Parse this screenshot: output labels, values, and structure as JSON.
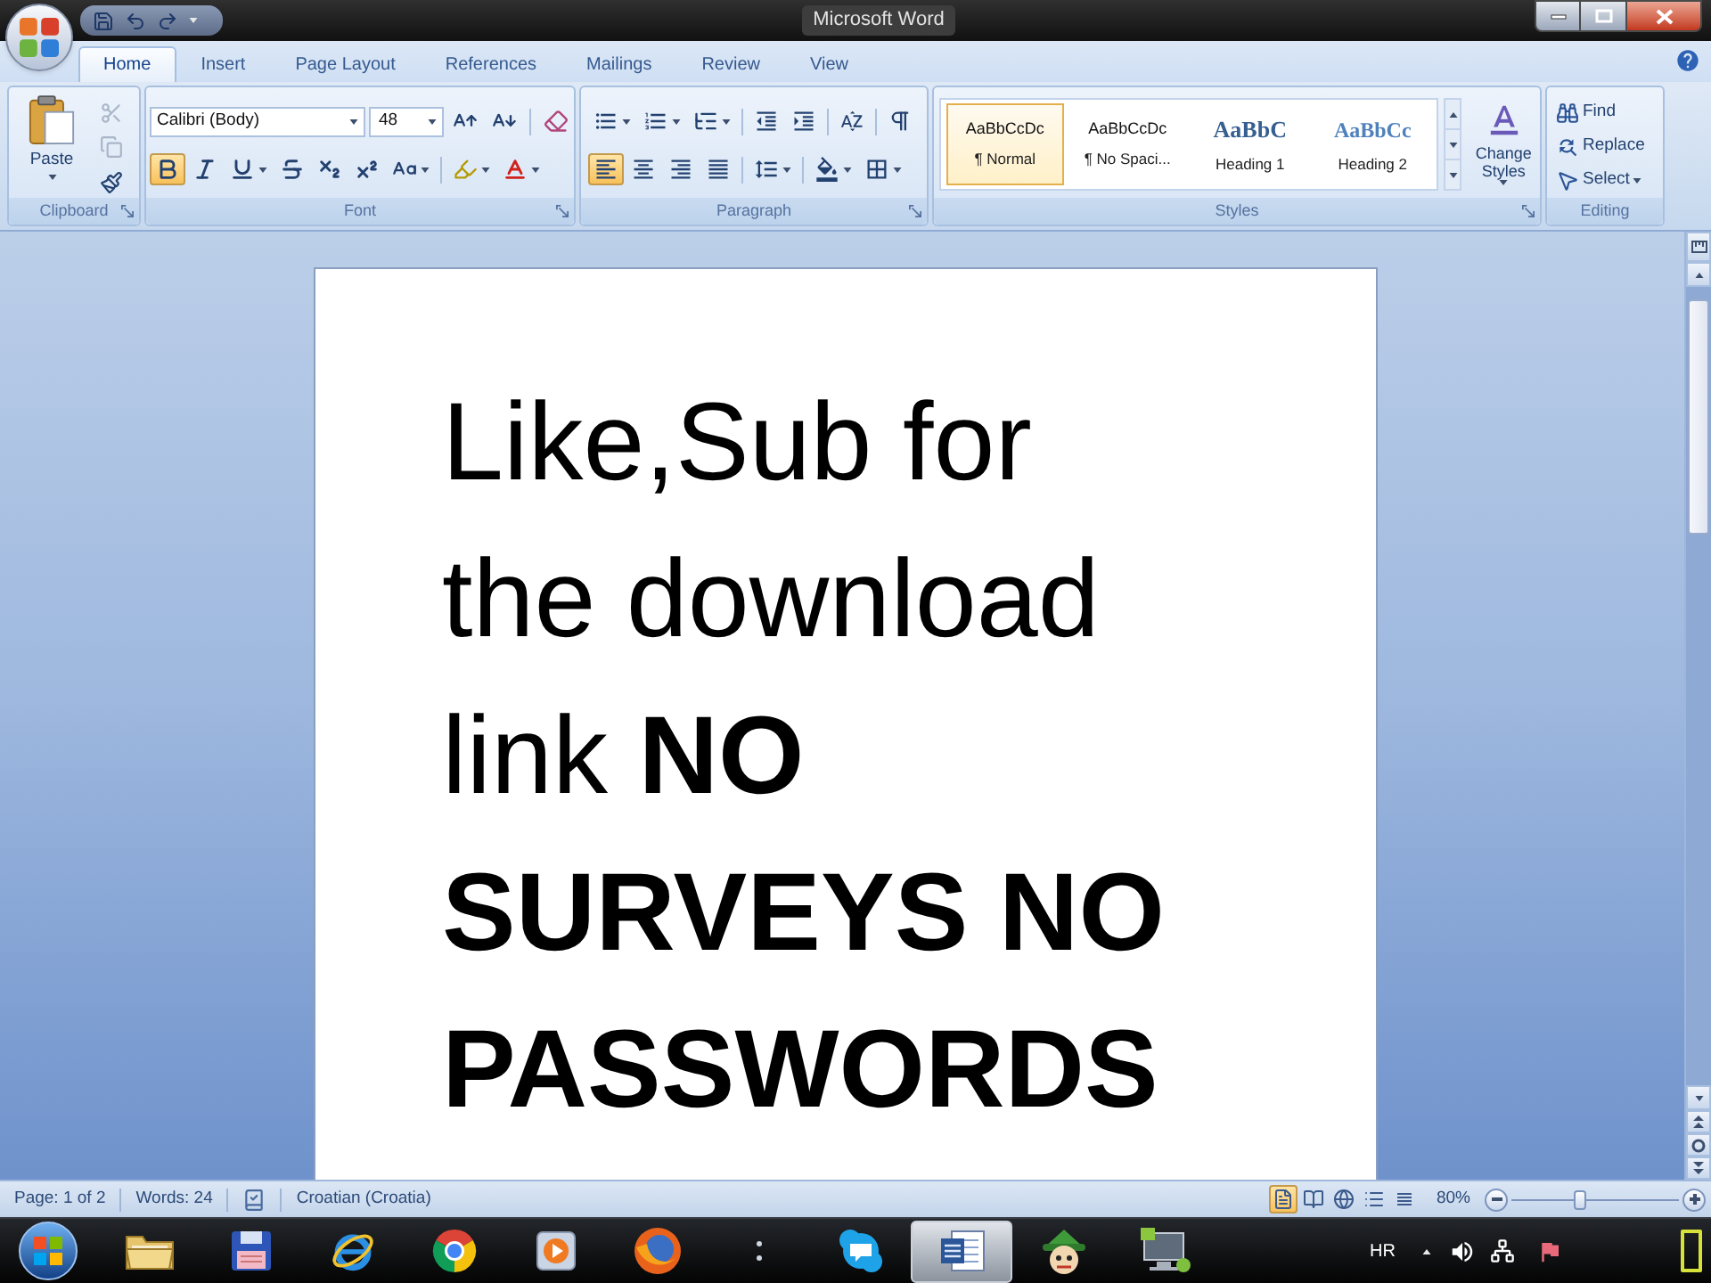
{
  "window": {
    "title": "Microsoft Word"
  },
  "tabs": [
    {
      "label": "Home",
      "selected": true
    },
    {
      "label": "Insert",
      "selected": false
    },
    {
      "label": "Page Layout",
      "selected": false
    },
    {
      "label": "References",
      "selected": false
    },
    {
      "label": "Mailings",
      "selected": false
    },
    {
      "label": "Review",
      "selected": false
    },
    {
      "label": "View",
      "selected": false
    }
  ],
  "clipboard": {
    "label": "Clipboard",
    "paste": "Paste",
    "tools": [
      {
        "kind": "cut",
        "disabled": true
      },
      {
        "kind": "copy",
        "disabled": true
      },
      {
        "kind": "format_painter",
        "disabled": false
      }
    ]
  },
  "font": {
    "label": "Font",
    "font_name": "Calibri (Body)",
    "font_size": "48",
    "bold": true,
    "italic": false,
    "underline": false,
    "strikethrough": false,
    "subscript": false,
    "superscript": false
  },
  "paragraph": {
    "label": "Paragraph",
    "alignments": [
      {
        "kind": "left",
        "selected": true
      },
      {
        "kind": "center",
        "selected": false
      },
      {
        "kind": "right",
        "selected": false
      },
      {
        "kind": "justify",
        "selected": false
      }
    ]
  },
  "styles": {
    "label": "Styles",
    "gallery": [
      {
        "kind": "body",
        "preview": "AaBbCcDc",
        "name": "¶ Normal",
        "selected": true
      },
      {
        "kind": "body",
        "preview": "AaBbCcDc",
        "name": "¶ No Spaci...",
        "selected": false
      },
      {
        "kind": "heading1",
        "preview": "AaBbC",
        "name": "Heading 1",
        "selected": false
      },
      {
        "kind": "heading2",
        "preview": "AaBbCc",
        "name": "Heading 2",
        "selected": false
      }
    ],
    "change_styles": "Change Styles"
  },
  "editing": {
    "label": "Editing",
    "items": [
      {
        "kind": "find",
        "label": "Find"
      },
      {
        "kind": "replace",
        "label": "Replace"
      },
      {
        "kind": "select",
        "label": "Select"
      }
    ]
  },
  "document": {
    "paragraph": "Like,Sub for the download link **NO SURVEYS NO PASSWORDS**"
  },
  "status_bar": {
    "page": "Page: 1 of 2",
    "words": "Words: 24",
    "language": "Croatian (Croatia)",
    "views": [
      {
        "kind": "print_layout",
        "selected": true
      },
      {
        "kind": "full_screen",
        "selected": false
      },
      {
        "kind": "web_layout",
        "selected": false
      },
      {
        "kind": "outline",
        "selected": false
      },
      {
        "kind": "draft",
        "selected": false
      }
    ],
    "zoom": "80%",
    "zoom_slider": {
      "level": 0.4
    }
  },
  "taskbar": {
    "apps": [
      {
        "kind": "folder",
        "selected": false
      },
      {
        "kind": "floppy",
        "selected": false
      },
      {
        "kind": "ring_browser",
        "selected": false
      },
      {
        "kind": "wheel_browser",
        "selected": false
      },
      {
        "kind": "player",
        "selected": false
      },
      {
        "kind": "fox_browser",
        "selected": false
      },
      {
        "kind": "dots",
        "selected": false
      },
      {
        "kind": "chat",
        "selected": false
      },
      {
        "kind": "word",
        "selected": true
      },
      {
        "kind": "character",
        "selected": false
      },
      {
        "kind": "monitor",
        "selected": false
      }
    ],
    "language": "HR"
  }
}
